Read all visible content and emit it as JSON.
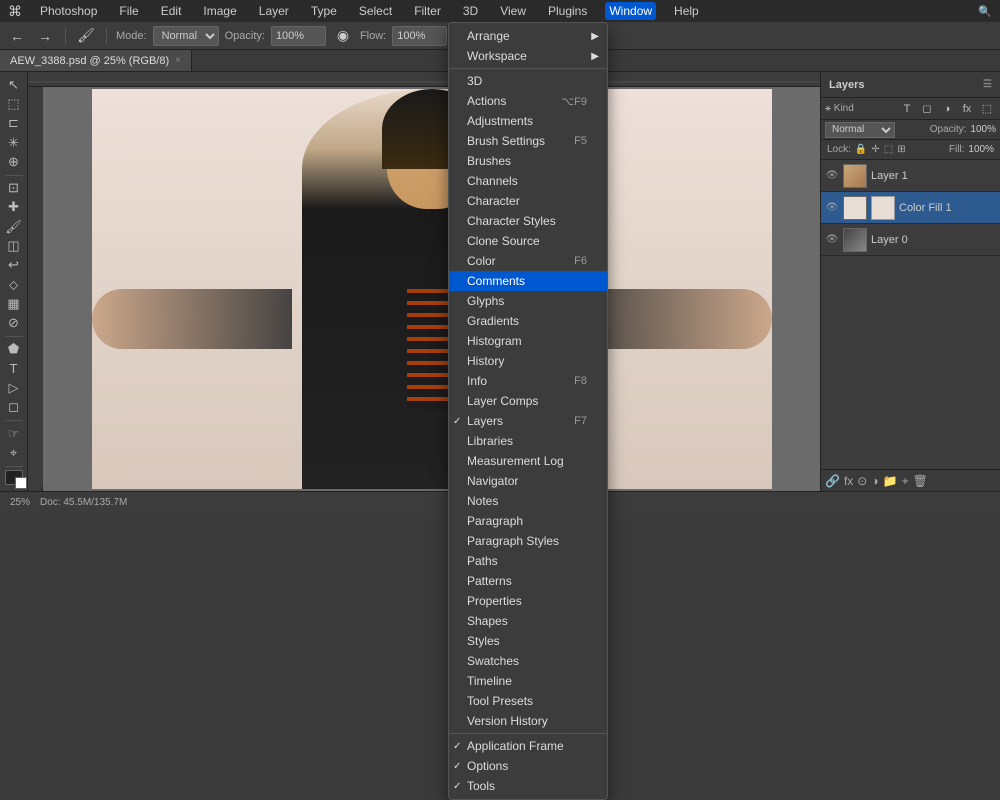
{
  "app": {
    "name": "Photoshop",
    "title": "photoshop"
  },
  "menubar": {
    "apple": "⌘",
    "items": [
      {
        "label": "Photoshop",
        "active": false
      },
      {
        "label": "File",
        "active": false
      },
      {
        "label": "Edit",
        "active": false
      },
      {
        "label": "Image",
        "active": false
      },
      {
        "label": "Layer",
        "active": false
      },
      {
        "label": "Type",
        "active": false
      },
      {
        "label": "Select",
        "active": false
      },
      {
        "label": "Filter",
        "active": false
      },
      {
        "label": "3D",
        "active": false
      },
      {
        "label": "View",
        "active": false
      },
      {
        "label": "Plugins",
        "active": false
      },
      {
        "label": "Window",
        "active": true
      },
      {
        "label": "Help",
        "active": false
      }
    ]
  },
  "toolbar": {
    "mode_label": "Mode:",
    "mode_value": "Normal",
    "opacity_label": "Opacity:",
    "opacity_value": "100%",
    "flow_label": "Flow:",
    "flow_value": "100%"
  },
  "tab": {
    "filename": "AEW_3388.psd @ 25% (RGB/8)",
    "modified": true
  },
  "window_menu": {
    "items": [
      {
        "label": "Arrange",
        "has_arrow": true,
        "shortcut": "",
        "check": false,
        "highlighted": false,
        "separator_after": false
      },
      {
        "label": "Workspace",
        "has_arrow": true,
        "shortcut": "",
        "check": false,
        "highlighted": false,
        "separator_after": true
      },
      {
        "label": "3D",
        "has_arrow": false,
        "shortcut": "",
        "check": false,
        "highlighted": false,
        "separator_after": false
      },
      {
        "label": "Actions",
        "has_arrow": false,
        "shortcut": "⌥F9",
        "check": false,
        "highlighted": false,
        "separator_after": false
      },
      {
        "label": "Adjustments",
        "has_arrow": false,
        "shortcut": "",
        "check": false,
        "highlighted": false,
        "separator_after": false
      },
      {
        "label": "Brush Settings",
        "has_arrow": false,
        "shortcut": "F5",
        "check": false,
        "highlighted": false,
        "separator_after": false
      },
      {
        "label": "Brushes",
        "has_arrow": false,
        "shortcut": "",
        "check": false,
        "highlighted": false,
        "separator_after": false
      },
      {
        "label": "Channels",
        "has_arrow": false,
        "shortcut": "",
        "check": false,
        "highlighted": false,
        "separator_after": false
      },
      {
        "label": "Character",
        "has_arrow": false,
        "shortcut": "",
        "check": false,
        "highlighted": false,
        "separator_after": false
      },
      {
        "label": "Character Styles",
        "has_arrow": false,
        "shortcut": "",
        "check": false,
        "highlighted": false,
        "separator_after": false
      },
      {
        "label": "Clone Source",
        "has_arrow": false,
        "shortcut": "",
        "check": false,
        "highlighted": false,
        "separator_after": false
      },
      {
        "label": "Color",
        "has_arrow": false,
        "shortcut": "F6",
        "check": false,
        "highlighted": false,
        "separator_after": false
      },
      {
        "label": "Comments",
        "has_arrow": false,
        "shortcut": "",
        "check": false,
        "highlighted": true,
        "separator_after": false
      },
      {
        "label": "Glyphs",
        "has_arrow": false,
        "shortcut": "",
        "check": false,
        "highlighted": false,
        "separator_after": false
      },
      {
        "label": "Gradients",
        "has_arrow": false,
        "shortcut": "",
        "check": false,
        "highlighted": false,
        "separator_after": false
      },
      {
        "label": "Histogram",
        "has_arrow": false,
        "shortcut": "",
        "check": false,
        "highlighted": false,
        "separator_after": false
      },
      {
        "label": "History",
        "has_arrow": false,
        "shortcut": "",
        "check": false,
        "highlighted": false,
        "separator_after": false
      },
      {
        "label": "Info",
        "has_arrow": false,
        "shortcut": "F8",
        "check": false,
        "highlighted": false,
        "separator_after": false
      },
      {
        "label": "Layer Comps",
        "has_arrow": false,
        "shortcut": "",
        "check": false,
        "highlighted": false,
        "separator_after": false
      },
      {
        "label": "Layers",
        "has_arrow": false,
        "shortcut": "F7",
        "check": true,
        "highlighted": false,
        "separator_after": false
      },
      {
        "label": "Libraries",
        "has_arrow": false,
        "shortcut": "",
        "check": false,
        "highlighted": false,
        "separator_after": false
      },
      {
        "label": "Measurement Log",
        "has_arrow": false,
        "shortcut": "",
        "check": false,
        "highlighted": false,
        "separator_after": false
      },
      {
        "label": "Navigator",
        "has_arrow": false,
        "shortcut": "",
        "check": false,
        "highlighted": false,
        "separator_after": false
      },
      {
        "label": "Notes",
        "has_arrow": false,
        "shortcut": "",
        "check": false,
        "highlighted": false,
        "separator_after": false
      },
      {
        "label": "Paragraph",
        "has_arrow": false,
        "shortcut": "",
        "check": false,
        "highlighted": false,
        "separator_after": false
      },
      {
        "label": "Paragraph Styles",
        "has_arrow": false,
        "shortcut": "",
        "check": false,
        "highlighted": false,
        "separator_after": false
      },
      {
        "label": "Paths",
        "has_arrow": false,
        "shortcut": "",
        "check": false,
        "highlighted": false,
        "separator_after": false
      },
      {
        "label": "Patterns",
        "has_arrow": false,
        "shortcut": "",
        "check": false,
        "highlighted": false,
        "separator_after": false
      },
      {
        "label": "Properties",
        "has_arrow": false,
        "shortcut": "",
        "check": false,
        "highlighted": false,
        "separator_after": false
      },
      {
        "label": "Shapes",
        "has_arrow": false,
        "shortcut": "",
        "check": false,
        "highlighted": false,
        "separator_after": false
      },
      {
        "label": "Styles",
        "has_arrow": false,
        "shortcut": "",
        "check": false,
        "highlighted": false,
        "separator_after": false
      },
      {
        "label": "Swatches",
        "has_arrow": false,
        "shortcut": "",
        "check": false,
        "highlighted": false,
        "separator_after": false
      },
      {
        "label": "Timeline",
        "has_arrow": false,
        "shortcut": "",
        "check": false,
        "highlighted": false,
        "separator_after": false
      },
      {
        "label": "Tool Presets",
        "has_arrow": false,
        "shortcut": "",
        "check": false,
        "highlighted": false,
        "separator_after": false
      },
      {
        "label": "Version History",
        "has_arrow": false,
        "shortcut": "",
        "check": false,
        "highlighted": false,
        "separator_after": true
      },
      {
        "label": "Application Frame",
        "has_arrow": false,
        "shortcut": "",
        "check": true,
        "highlighted": false,
        "separator_after": false
      },
      {
        "label": "Options",
        "has_arrow": false,
        "shortcut": "",
        "check": true,
        "highlighted": false,
        "separator_after": false
      },
      {
        "label": "Tools",
        "has_arrow": false,
        "shortcut": "",
        "check": true,
        "highlighted": false,
        "separator_after": false
      }
    ]
  },
  "layers_panel": {
    "title": "Layers",
    "mode": "Normal",
    "opacity": "Opacity: 100%",
    "fill": "Fill: 100%",
    "lock_label": "Lock:",
    "layers": [
      {
        "name": "Layer 1",
        "type": "person",
        "visible": true,
        "selected": false
      },
      {
        "name": "Color Fill 1",
        "type": "color-fill",
        "visible": true,
        "selected": true
      },
      {
        "name": "Layer 0",
        "type": "dark",
        "visible": true,
        "selected": false
      }
    ]
  },
  "status": {
    "zoom": "25%",
    "doc_info": "Doc: 45.5M/135.7M"
  },
  "tools": [
    {
      "icon": "↖",
      "name": "move-tool"
    },
    {
      "icon": "⬚",
      "name": "selection-tool"
    },
    {
      "icon": "✂",
      "name": "lasso-tool"
    },
    {
      "icon": "⊕",
      "name": "crop-tool"
    },
    {
      "icon": "⊡",
      "name": "eyedropper-tool"
    },
    {
      "icon": "✱",
      "name": "healing-tool"
    },
    {
      "icon": "🖌",
      "name": "brush-tool"
    },
    {
      "icon": "◫",
      "name": "stamp-tool"
    },
    {
      "icon": "↩",
      "name": "history-tool"
    },
    {
      "icon": "⬦",
      "name": "eraser-tool"
    },
    {
      "icon": "▦",
      "name": "gradient-tool"
    },
    {
      "icon": "⊘",
      "name": "dodge-tool"
    },
    {
      "icon": "⬟",
      "name": "pen-tool"
    },
    {
      "icon": "T",
      "name": "type-tool"
    },
    {
      "icon": "▷",
      "name": "path-select-tool"
    },
    {
      "icon": "◻",
      "name": "shape-tool"
    },
    {
      "icon": "☞",
      "name": "hand-tool"
    },
    {
      "icon": "⌖",
      "name": "zoom-tool"
    }
  ]
}
